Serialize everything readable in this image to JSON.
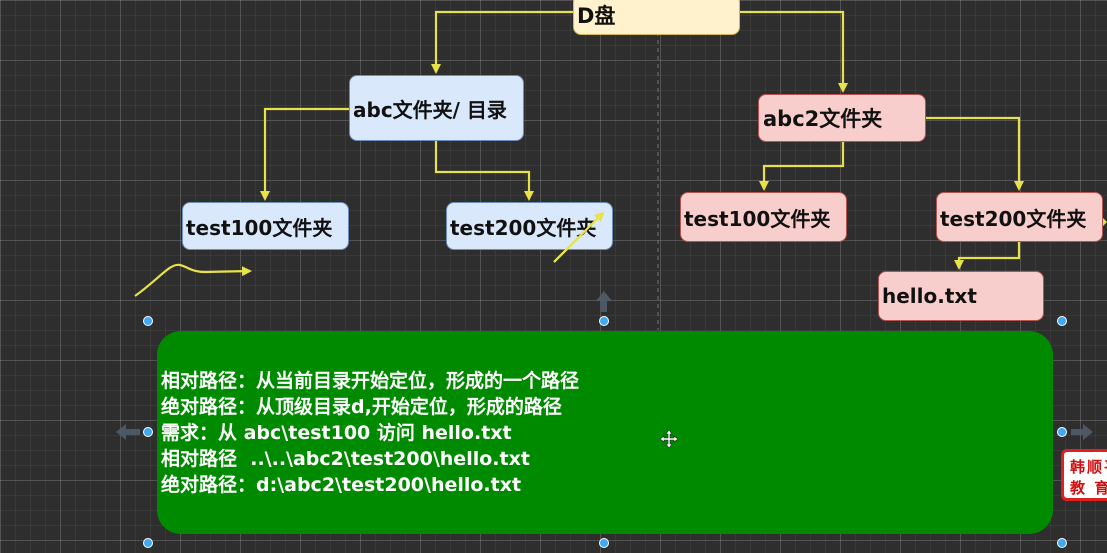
{
  "nodes": {
    "root": "D盘",
    "abc": "abc文件夹/ 目录",
    "abc_test100": "test100文件夹",
    "abc_test200": "test200文件夹",
    "abc2": "abc2文件夹",
    "abc2_test100": "test100文件夹",
    "abc2_test200": "test200文件夹",
    "hello": "hello.txt"
  },
  "notes": [
    "相对路径：从当前目录开始定位，形成的一个路径",
    "绝对路径：从顶级目录d,开始定位，形成的路径",
    "需求：从 abc\\test100 访问 hello.txt",
    "相对路径  ..\\..\\abc2\\test200\\hello.txt",
    "绝对路径：d:\\abc2\\test200\\hello.txt"
  ],
  "watermark": [
    "韩顺平",
    "教 育"
  ],
  "colors": {
    "background": "#2e2e2e",
    "connector": "#e8e24a",
    "blue_node": "#dae8fc",
    "pink_node": "#f8cecc",
    "root_node": "#fff2cc",
    "note_box": "#008a00",
    "handle": "#3fa9f5"
  },
  "icons": [
    "move-cursor-icon",
    "arrow-left-icon",
    "arrow-right-icon",
    "arrow-up-icon"
  ]
}
